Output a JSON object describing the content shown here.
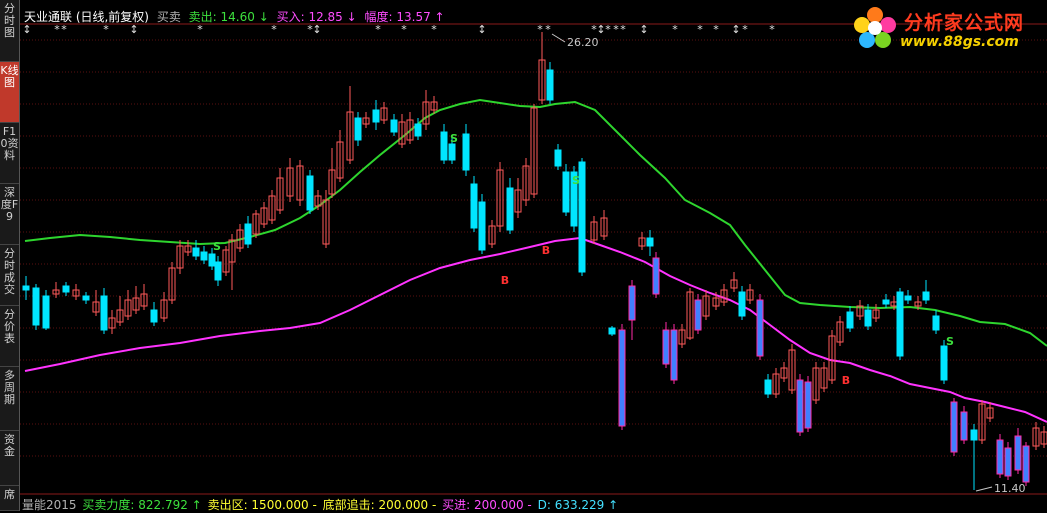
{
  "sidebar": {
    "tabs": [
      {
        "label": "分时图",
        "active": false
      },
      {
        "label": "K线图",
        "active": true
      },
      {
        "label": "F10资料",
        "active": false
      },
      {
        "label": "深度F9",
        "active": false
      },
      {
        "label": "分时成交",
        "active": false
      },
      {
        "label": "分价表",
        "active": false
      },
      {
        "label": "多周期",
        "active": false
      },
      {
        "label": "资金",
        "active": false
      },
      {
        "label": "席",
        "active": false
      }
    ]
  },
  "header": {
    "title": "天业通联 (日线,前复权)",
    "indicator": "买卖",
    "sell_text": "卖出: 14.60 ↓",
    "buy_text": "买入: 12.85 ↓",
    "amplitude_text": "幅度: 13.57 ↑"
  },
  "footer": {
    "indicator": "量能2015",
    "force_text": "买卖力度: 822.792 ↑",
    "sell_zone_text": "卖出区: 1500.000 -",
    "bottom_text": "底部追击: 200.000 -",
    "buy_text": "买进: 200.000 -",
    "d_text": "D: 633.229 ↑"
  },
  "annotations": {
    "high_price": "26.20",
    "low_price": "11.40",
    "buy_marker": "B",
    "sell_marker": "S"
  },
  "logo": {
    "title": "分析家公式网",
    "url": "www.88gs.com"
  },
  "colors": {
    "rise": "#ff5a5a",
    "fall": "#00e5ff",
    "buy_candle": "#ff2da8",
    "buy_candle_fill": "#4080ff",
    "upper_line": "#2ed52e",
    "lower_line": "#ff33ff",
    "grid": "#5a1010"
  },
  "chart_data": {
    "type": "candlestick",
    "title": "天业通联 (日线,前复权)",
    "high_label": 26.2,
    "low_label": 11.4,
    "sell_price": 14.6,
    "buy_price": 12.85,
    "amplitude": 13.57,
    "legend": "none",
    "grid": true
  }
}
